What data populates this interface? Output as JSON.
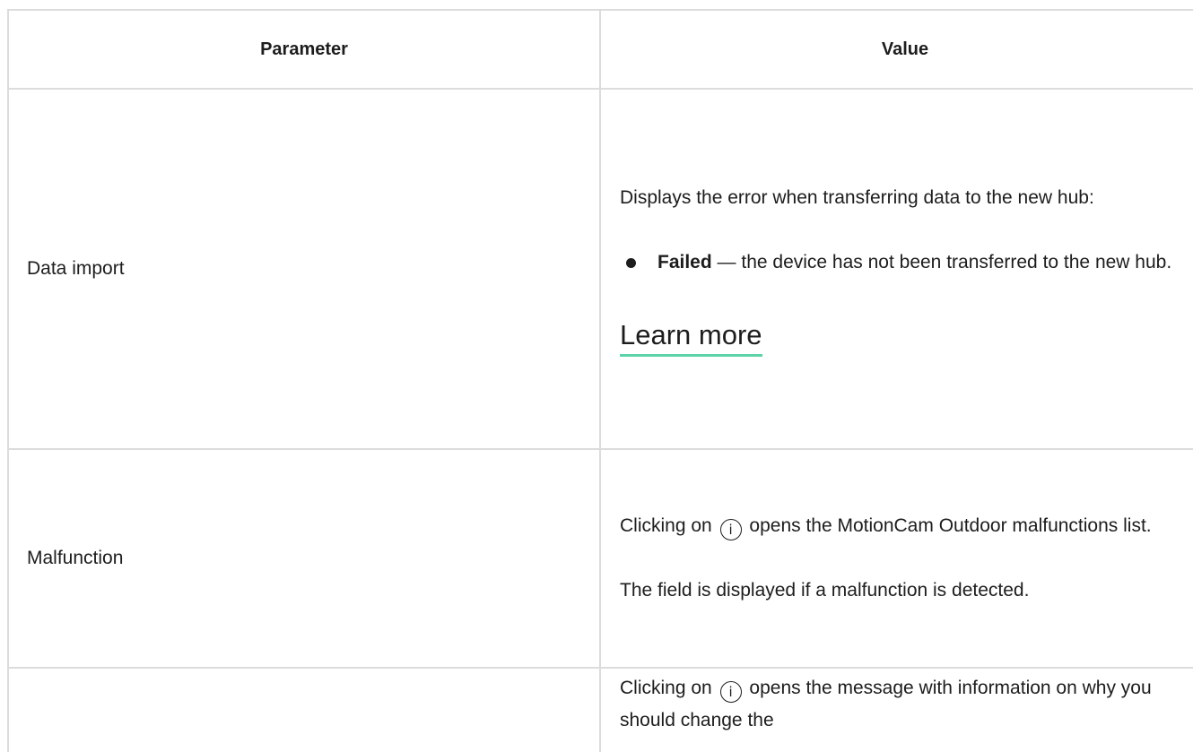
{
  "table": {
    "headers": {
      "parameter": "Parameter",
      "value": "Value"
    },
    "rows": [
      {
        "parameter": "Data import",
        "value_text": "Displays the error when transferring data to the new hub:",
        "bullet_bold": "Failed",
        "bullet_rest": " — the device has not been transferred to the new hub.",
        "link_label": "Learn more"
      },
      {
        "parameter": "Malfunction",
        "value_before_icon": "Clicking on",
        "value_after_icon": "opens the MotionCam Outdoor malfunctions list.",
        "value_note": "The field is displayed if a malfunction is detected."
      },
      {
        "parameter": "",
        "value_before_icon": "Clicking on",
        "value_after_icon": "opens the message with information on why you should change the"
      }
    ]
  },
  "icons": {
    "info": "info-circle-icon"
  }
}
